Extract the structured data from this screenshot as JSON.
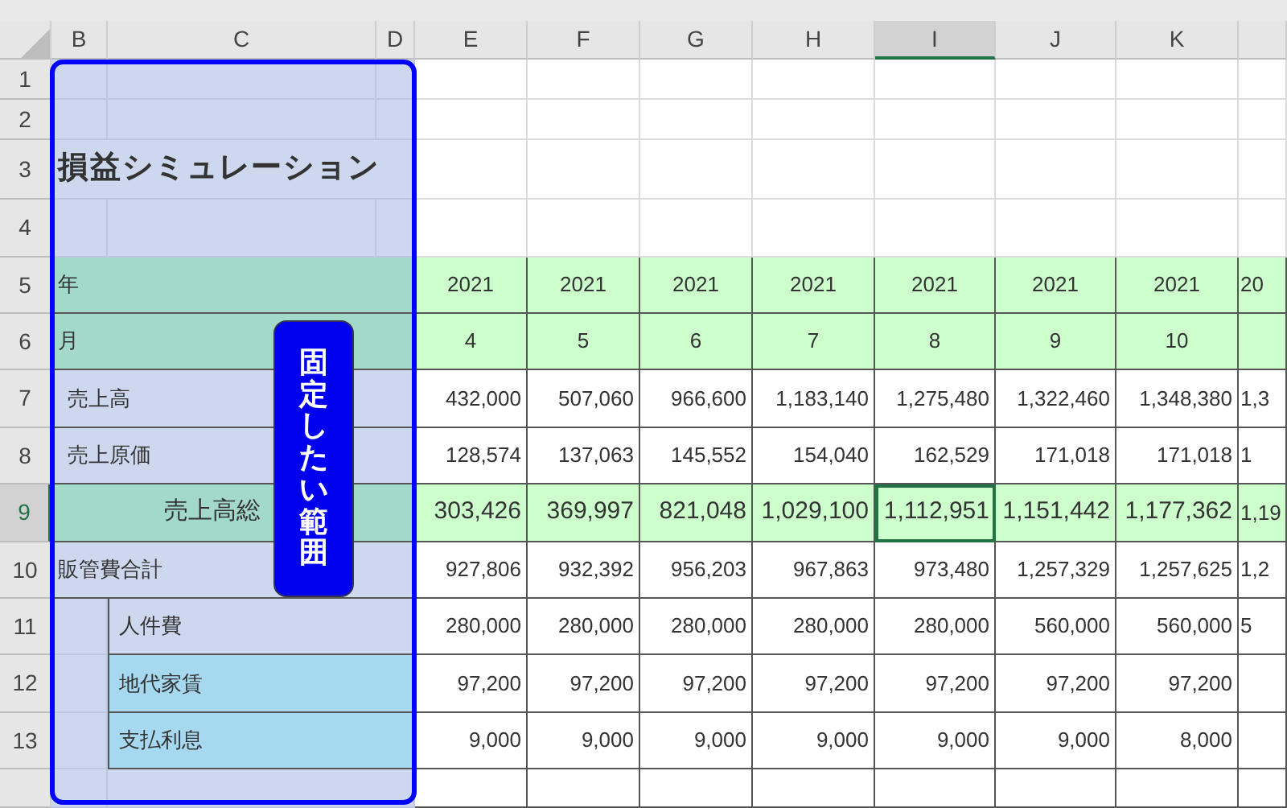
{
  "columns": [
    {
      "label": "B",
      "selected": false
    },
    {
      "label": "C",
      "selected": false
    },
    {
      "label": "D",
      "selected": false
    },
    {
      "label": "E",
      "selected": false
    },
    {
      "label": "F",
      "selected": false
    },
    {
      "label": "G",
      "selected": false
    },
    {
      "label": "H",
      "selected": false
    },
    {
      "label": "I",
      "selected": true
    },
    {
      "label": "J",
      "selected": false
    },
    {
      "label": "K",
      "selected": false
    }
  ],
  "rows": [
    {
      "number": "1",
      "selected": false
    },
    {
      "number": "2",
      "selected": false
    },
    {
      "number": "3",
      "selected": false,
      "kind": "title",
      "label": "損益シミュレーション"
    },
    {
      "number": "4",
      "selected": false
    },
    {
      "number": "5",
      "selected": false,
      "kind": "header",
      "label": "年",
      "color": "#a3d9c9",
      "values": [
        "2021",
        "2021",
        "2021",
        "2021",
        "2021",
        "2021",
        "2021",
        "20"
      ]
    },
    {
      "number": "6",
      "selected": false,
      "kind": "header",
      "label": "月",
      "color": "#a3d9c9",
      "values": [
        "4",
        "5",
        "6",
        "7",
        "8",
        "9",
        "10"
      ]
    },
    {
      "number": "7",
      "selected": false,
      "kind": "item",
      "label": "売上高",
      "color": "#cdd8ef",
      "values": [
        "432,000",
        "507,060",
        "966,600",
        "1,183,140",
        "1,275,480",
        "1,322,460",
        "1,348,380",
        "1,3"
      ]
    },
    {
      "number": "8",
      "selected": false,
      "kind": "item",
      "label": "売上原価",
      "color": "#cdd8ef",
      "values": [
        "128,574",
        "137,063",
        "145,552",
        "154,040",
        "162,529",
        "171,018",
        "171,018",
        "1"
      ]
    },
    {
      "number": "9",
      "selected": true,
      "kind": "total",
      "label": "売上高総",
      "color": "#a3d9c9",
      "values": [
        "303,426",
        "369,997",
        "821,048",
        "1,029,100",
        "1,112,951",
        "1,151,442",
        "1,177,362",
        "1,19"
      ]
    },
    {
      "number": "10",
      "selected": false,
      "kind": "group",
      "label": "販管費合計",
      "color": "#cdd8ef",
      "values": [
        "927,806",
        "932,392",
        "956,203",
        "967,863",
        "973,480",
        "1,257,329",
        "1,257,625",
        "1,2"
      ]
    },
    {
      "number": "11",
      "selected": false,
      "kind": "sub",
      "label": "人件費",
      "color": "#cdd8ef",
      "values": [
        "280,000",
        "280,000",
        "280,000",
        "280,000",
        "280,000",
        "560,000",
        "560,000",
        "5"
      ]
    },
    {
      "number": "12",
      "selected": false,
      "kind": "sub",
      "label": "地代家賃",
      "color": "#a6d8ef",
      "values": [
        "97,200",
        "97,200",
        "97,200",
        "97,200",
        "97,200",
        "97,200",
        "97,200"
      ]
    },
    {
      "number": "13",
      "selected": false,
      "kind": "sub",
      "label": "支払利息",
      "color": "#a6d8ef",
      "values": [
        "9,000",
        "9,000",
        "9,000",
        "9,000",
        "9,000",
        "9,000",
        "8,000"
      ]
    }
  ],
  "callout": {
    "text": "固定したい範囲"
  }
}
